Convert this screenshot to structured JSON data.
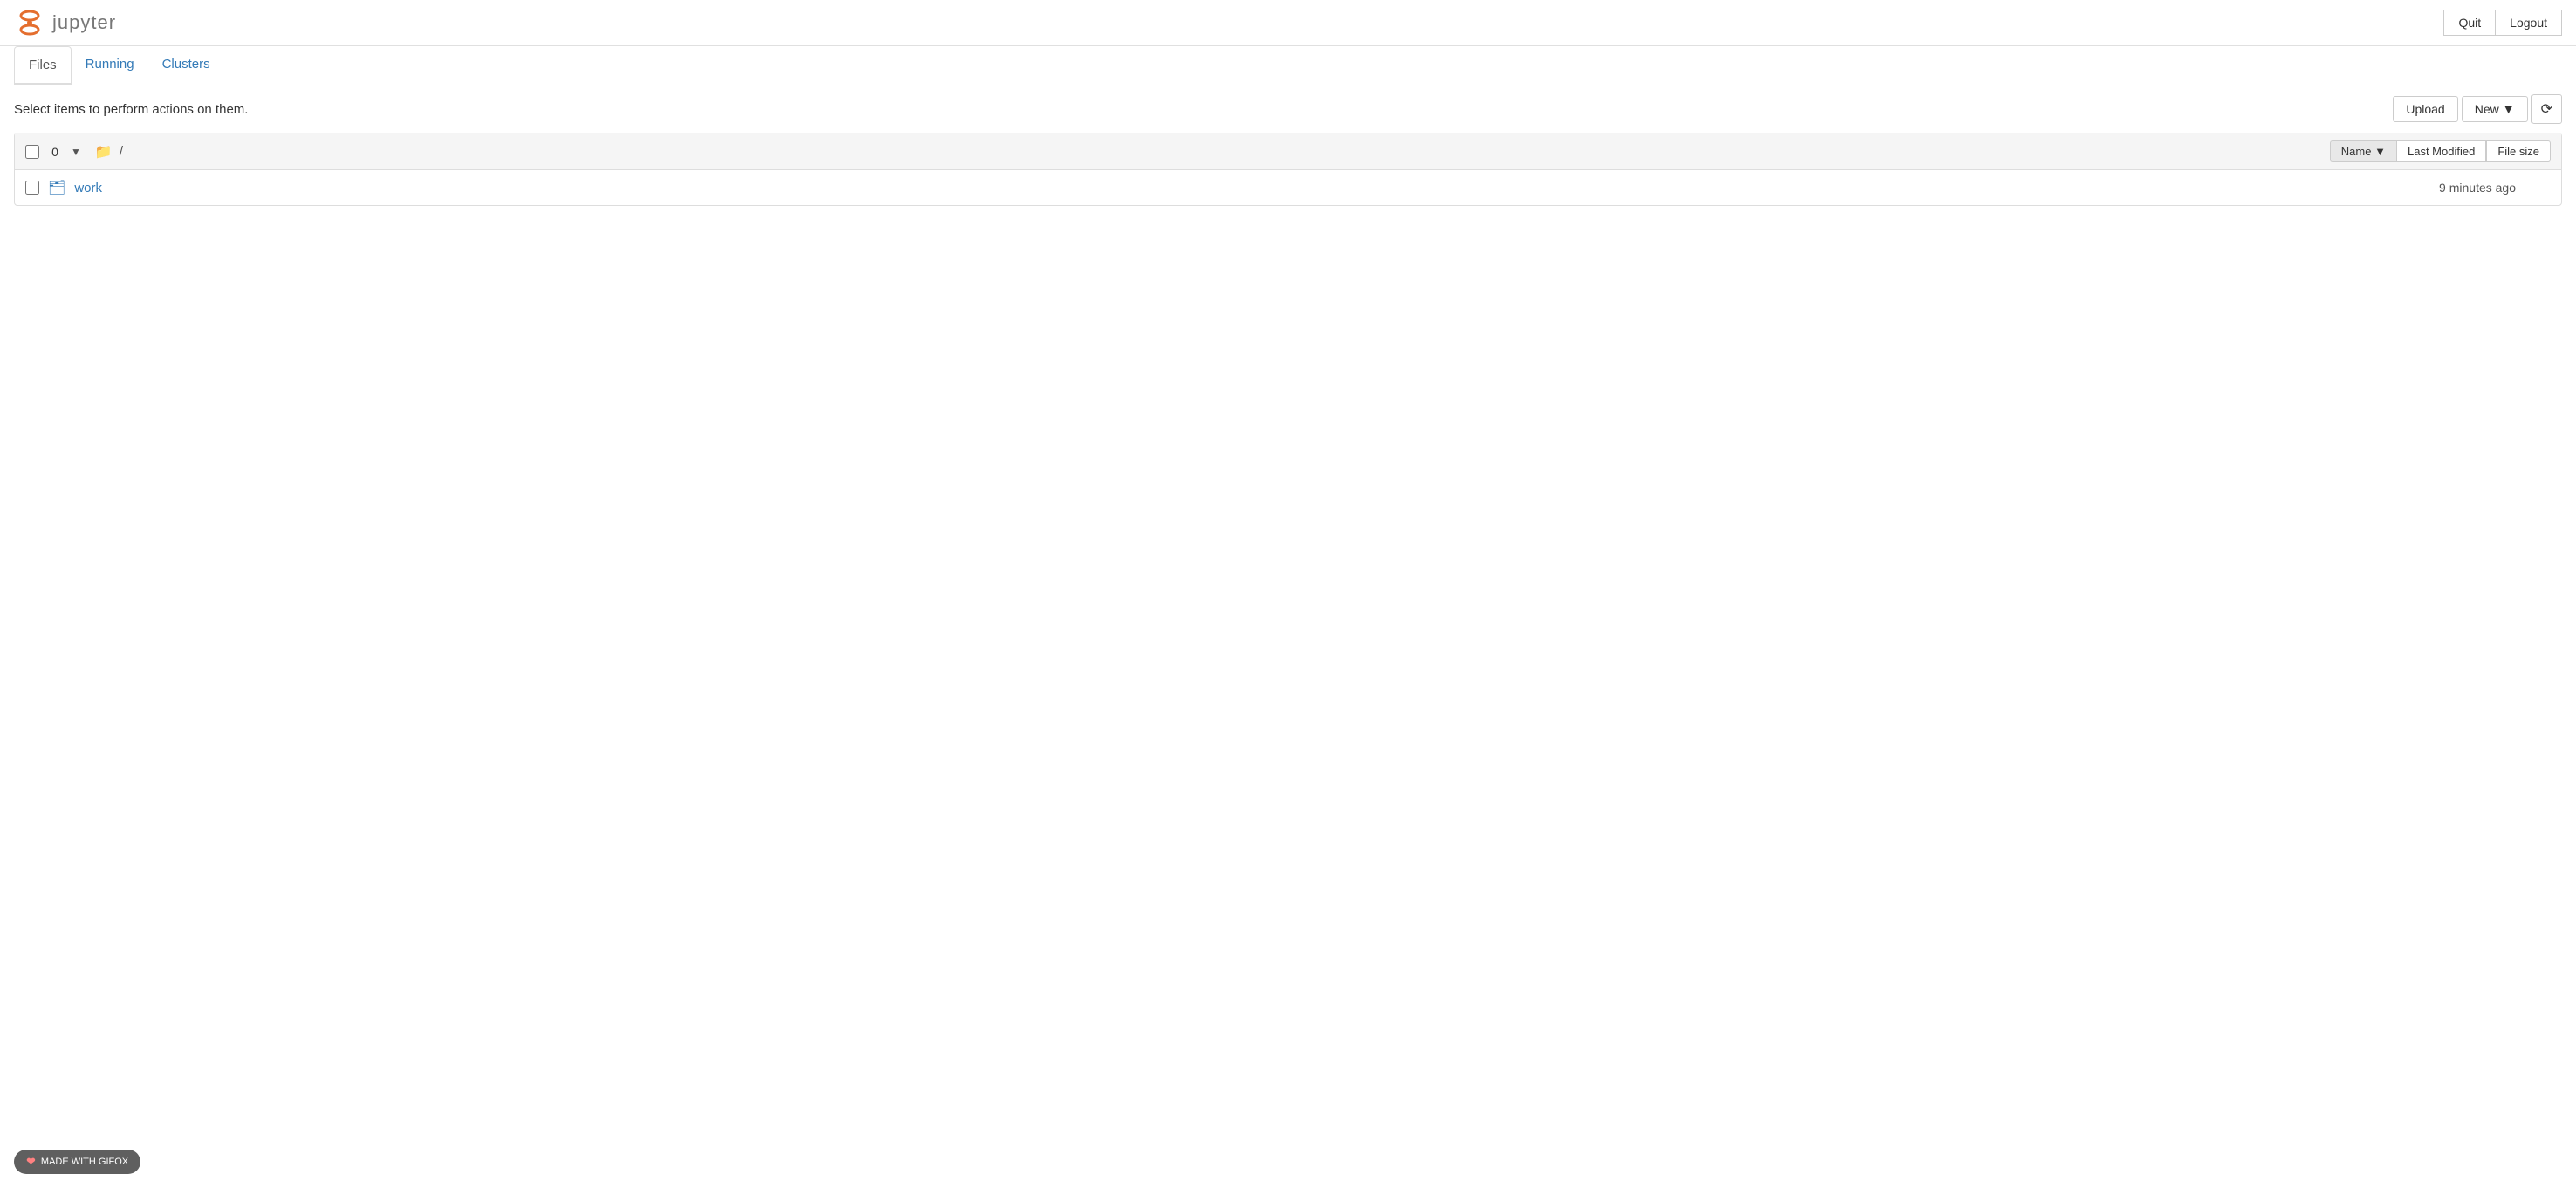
{
  "header": {
    "logo_text": "jupyter",
    "quit_label": "Quit",
    "logout_label": "Logout"
  },
  "tabs": [
    {
      "label": "Files",
      "active": true
    },
    {
      "label": "Running",
      "active": false
    },
    {
      "label": "Clusters",
      "active": false
    }
  ],
  "toolbar": {
    "select_message": "Select items to perform actions on them.",
    "upload_label": "Upload",
    "new_label": "New",
    "new_dropdown_icon": "▼",
    "refresh_icon": "⟳"
  },
  "file_list": {
    "count": "0",
    "path": "/",
    "sort_name_label": "Name",
    "sort_arrow": "▼",
    "sort_modified_label": "Last Modified",
    "sort_size_label": "File size",
    "items": [
      {
        "name": "work",
        "type": "folder",
        "modified": "9 minutes ago"
      }
    ]
  },
  "watermark": {
    "text": "MADE WITH GIFOX"
  }
}
